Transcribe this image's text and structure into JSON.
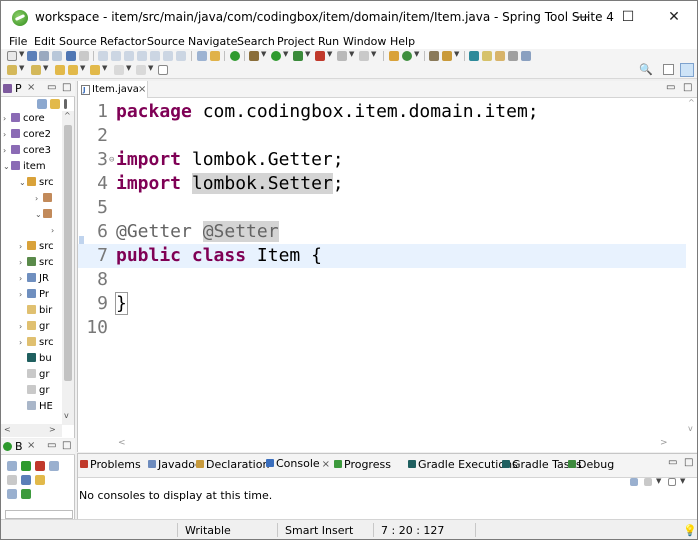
{
  "window": {
    "title": "workspace - item/src/main/java/com/codingbox/item/domain/item/Item.java - Spring Tool Suite 4",
    "minimize": "—",
    "maximize": "☐",
    "close": "✕"
  },
  "menu": {
    "items": [
      {
        "label": "File"
      },
      {
        "label": "Edit"
      },
      {
        "label": "Source"
      },
      {
        "label": "Refactor"
      },
      {
        "label": "Source"
      },
      {
        "label": "Navigate"
      },
      {
        "label": "Search"
      },
      {
        "label": "Project"
      },
      {
        "label": "Run"
      },
      {
        "label": "Window"
      },
      {
        "label": "Help"
      }
    ]
  },
  "package_explorer": {
    "tab_label": "P",
    "close": "×",
    "items": [
      {
        "label": "core"
      },
      {
        "label": "core2"
      },
      {
        "label": "core3"
      },
      {
        "label": "item"
      },
      {
        "label": "src"
      },
      {
        "label": ""
      },
      {
        "label": ""
      },
      {
        "label": ""
      },
      {
        "label": "src"
      },
      {
        "label": "src"
      },
      {
        "label": "JR"
      },
      {
        "label": "Pr"
      },
      {
        "label": "bir"
      },
      {
        "label": "gr"
      },
      {
        "label": "src"
      },
      {
        "label": "bu"
      },
      {
        "label": "gr"
      },
      {
        "label": "gr"
      },
      {
        "label": "HE"
      }
    ]
  },
  "outline_view": {
    "tab_label": "B",
    "close": "×"
  },
  "editor": {
    "tab_label": "Item.java",
    "tab_close": "×",
    "lines": [
      {
        "num": "1",
        "tokens": [
          {
            "t": "package",
            "c": "kw"
          },
          {
            "t": " com.codingbox.item.domain.item;",
            "c": ""
          }
        ]
      },
      {
        "num": "2",
        "tokens": []
      },
      {
        "num": "3",
        "tokens": [
          {
            "t": "import",
            "c": "kw"
          },
          {
            "t": " lombok.Getter;",
            "c": ""
          }
        ]
      },
      {
        "num": "4",
        "tokens": [
          {
            "t": "import",
            "c": "kw"
          },
          {
            "t": " ",
            "c": ""
          },
          {
            "t": "lombok.Setter",
            "c": "occ"
          },
          {
            "t": ";",
            "c": ""
          }
        ]
      },
      {
        "num": "5",
        "tokens": []
      },
      {
        "num": "6",
        "tokens": [
          {
            "t": "@Getter",
            "c": "ann"
          },
          {
            "t": " ",
            "c": ""
          },
          {
            "t": "@Setter",
            "c": "ann occ"
          }
        ]
      },
      {
        "num": "7",
        "tokens": [
          {
            "t": "public",
            "c": "kw"
          },
          {
            "t": " ",
            "c": ""
          },
          {
            "t": "class",
            "c": "kw"
          },
          {
            "t": " Item {",
            "c": ""
          }
        ]
      },
      {
        "num": "8",
        "tokens": []
      },
      {
        "num": "9",
        "tokens": [
          {
            "t": "}",
            "c": "bracket"
          }
        ]
      },
      {
        "num": "10",
        "tokens": []
      }
    ],
    "current_line": 7
  },
  "console": {
    "tabs": [
      {
        "label": "Problems",
        "color": "#c0392b"
      },
      {
        "label": "Javadoc",
        "color": "#6d8bbd"
      },
      {
        "label": "Declaration",
        "color": "#c79a3c"
      },
      {
        "label": "Console",
        "color": "#3a6ebd",
        "active": true
      },
      {
        "label": "Progress",
        "color": "#3d9a3d"
      },
      {
        "label": "Gradle Executions",
        "color": "#1f5f5f"
      },
      {
        "label": "Gradle Tasks",
        "color": "#1f5f5f"
      },
      {
        "label": "Debug",
        "color": "#3d8a3d"
      }
    ],
    "close": "×",
    "message": "No consoles to display at this time."
  },
  "status_bar": {
    "writable": "Writable",
    "insert_mode": "Smart Insert",
    "position": "7 : 20 : 127"
  },
  "colors": {
    "keyword": "#7f0055",
    "annotation": "#646464",
    "current_line": "#e8f2fe",
    "occurrence": "#d4d4d4"
  }
}
